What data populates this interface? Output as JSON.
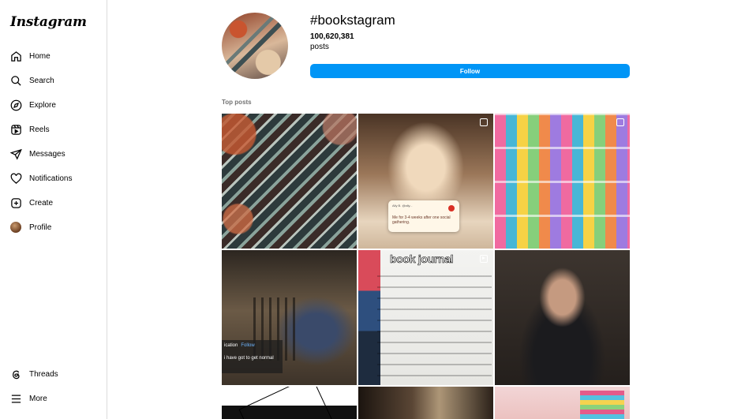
{
  "sidebar": {
    "logo": "Instagram",
    "items": [
      {
        "label": "Home",
        "icon": "home-icon"
      },
      {
        "label": "Search",
        "icon": "search-icon"
      },
      {
        "label": "Explore",
        "icon": "compass-icon"
      },
      {
        "label": "Reels",
        "icon": "reels-icon"
      },
      {
        "label": "Messages",
        "icon": "send-icon"
      },
      {
        "label": "Notifications",
        "icon": "heart-icon"
      },
      {
        "label": "Create",
        "icon": "plus-square-icon"
      },
      {
        "label": "Profile",
        "icon": "avatar"
      }
    ],
    "bottom_items": [
      {
        "label": "Threads",
        "icon": "threads-icon"
      },
      {
        "label": "More",
        "icon": "menu-icon"
      }
    ]
  },
  "header": {
    "hashtag": "#bookstagram",
    "post_count": "100,620,381",
    "post_count_label": "posts",
    "follow_label": "Follow"
  },
  "section_title": "Top posts",
  "posts": {
    "p2_overlay": {
      "handle": "Ally B. @ally...",
      "message": "Me for 3-4 weeks after one social gathering."
    },
    "p4_comment": {
      "name": "ication",
      "follow": "Follow",
      "text": "i have got to get normal"
    },
    "p5_title": "book journal"
  },
  "colors": {
    "accent": "#0095f6",
    "border": "#dbdbdb",
    "muted": "#737373"
  }
}
